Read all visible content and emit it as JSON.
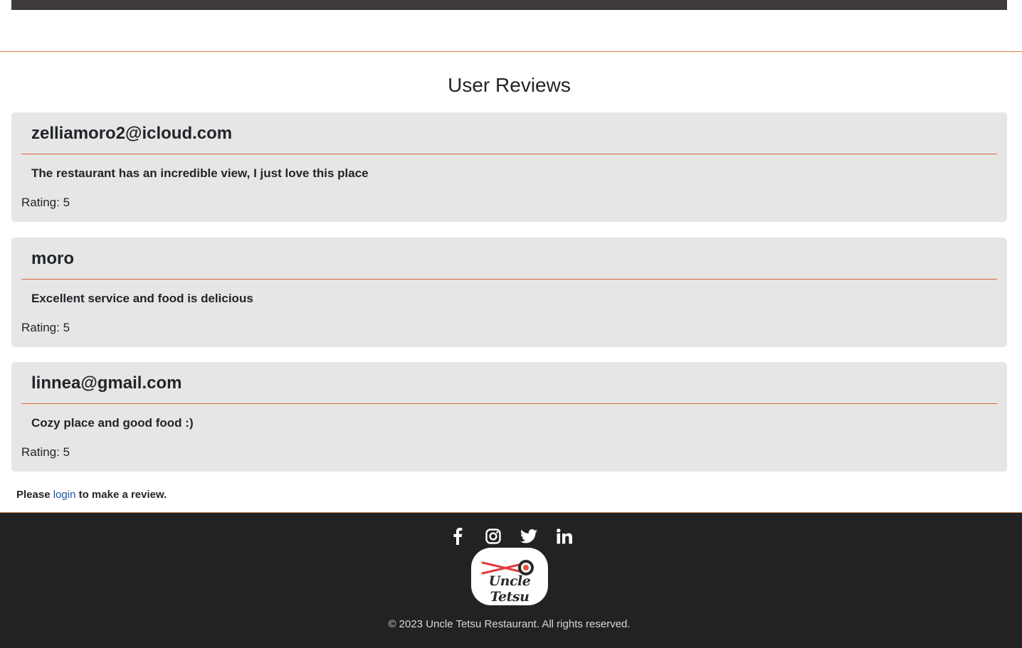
{
  "page": {
    "title": "User Reviews"
  },
  "reviews": [
    {
      "author": "zelliamoro2@icloud.com",
      "text": "The restaurant has an incredible view, I just love this place",
      "rating": "Rating: 5"
    },
    {
      "author": "moro",
      "text": "Excellent service and food is delicious",
      "rating": "Rating: 5"
    },
    {
      "author": "linnea@gmail.com",
      "text": "Cozy place and good food :)",
      "rating": "Rating: 5"
    }
  ],
  "login_note": {
    "prefix": "Please",
    "link": "login",
    "suffix": "to make a review."
  },
  "footer": {
    "social_icons": [
      "facebook-icon",
      "instagram-icon",
      "twitter-icon",
      "linkedin-icon"
    ],
    "logo_text": "Uncle Tetsu",
    "copyright": "© 2023 Uncle Tetsu Restaurant. All rights reserved."
  },
  "colors": {
    "accent": "#d9643a",
    "card_bg": "#e6e6e6",
    "footer_bg": "#222222",
    "link": "#1a56a8"
  }
}
